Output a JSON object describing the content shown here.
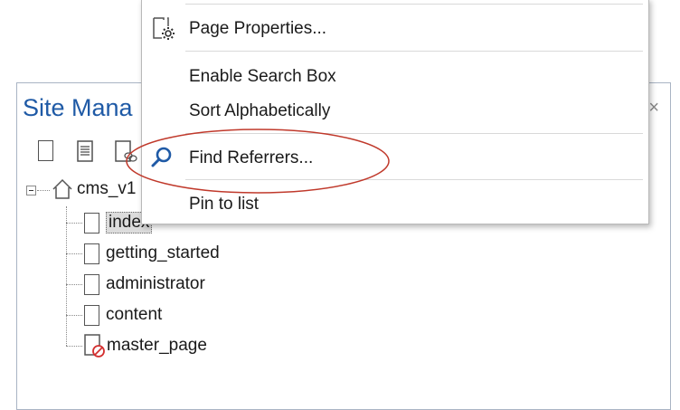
{
  "panel": {
    "title": "Site Mana",
    "close_glyph": "×"
  },
  "toolbar": {
    "icons": [
      "new-page-icon",
      "page-text-icon",
      "page-link-icon"
    ]
  },
  "tree": {
    "root": {
      "label": "cms_v1",
      "icon": "home-icon"
    },
    "children": [
      {
        "label": "index",
        "selected": true,
        "icon": "page-icon"
      },
      {
        "label": "getting_started",
        "icon": "page-icon"
      },
      {
        "label": "administrator",
        "icon": "page-icon"
      },
      {
        "label": "content",
        "icon": "page-icon"
      },
      {
        "label": "master_page",
        "icon": "page-blocked-icon"
      }
    ]
  },
  "menu": {
    "items": [
      {
        "label": "Page Properties...",
        "icon": "page-settings-icon"
      },
      {
        "label": "Enable Search Box"
      },
      {
        "label": "Sort Alphabetically"
      },
      {
        "label": "Find Referrers...",
        "icon": "search-icon"
      },
      {
        "label": "Pin to list"
      }
    ]
  },
  "colors": {
    "title": "#1f5aa6",
    "search_icon": "#1f5aa6",
    "annotation": "#c0392b",
    "blocked": "#d32f2f"
  }
}
